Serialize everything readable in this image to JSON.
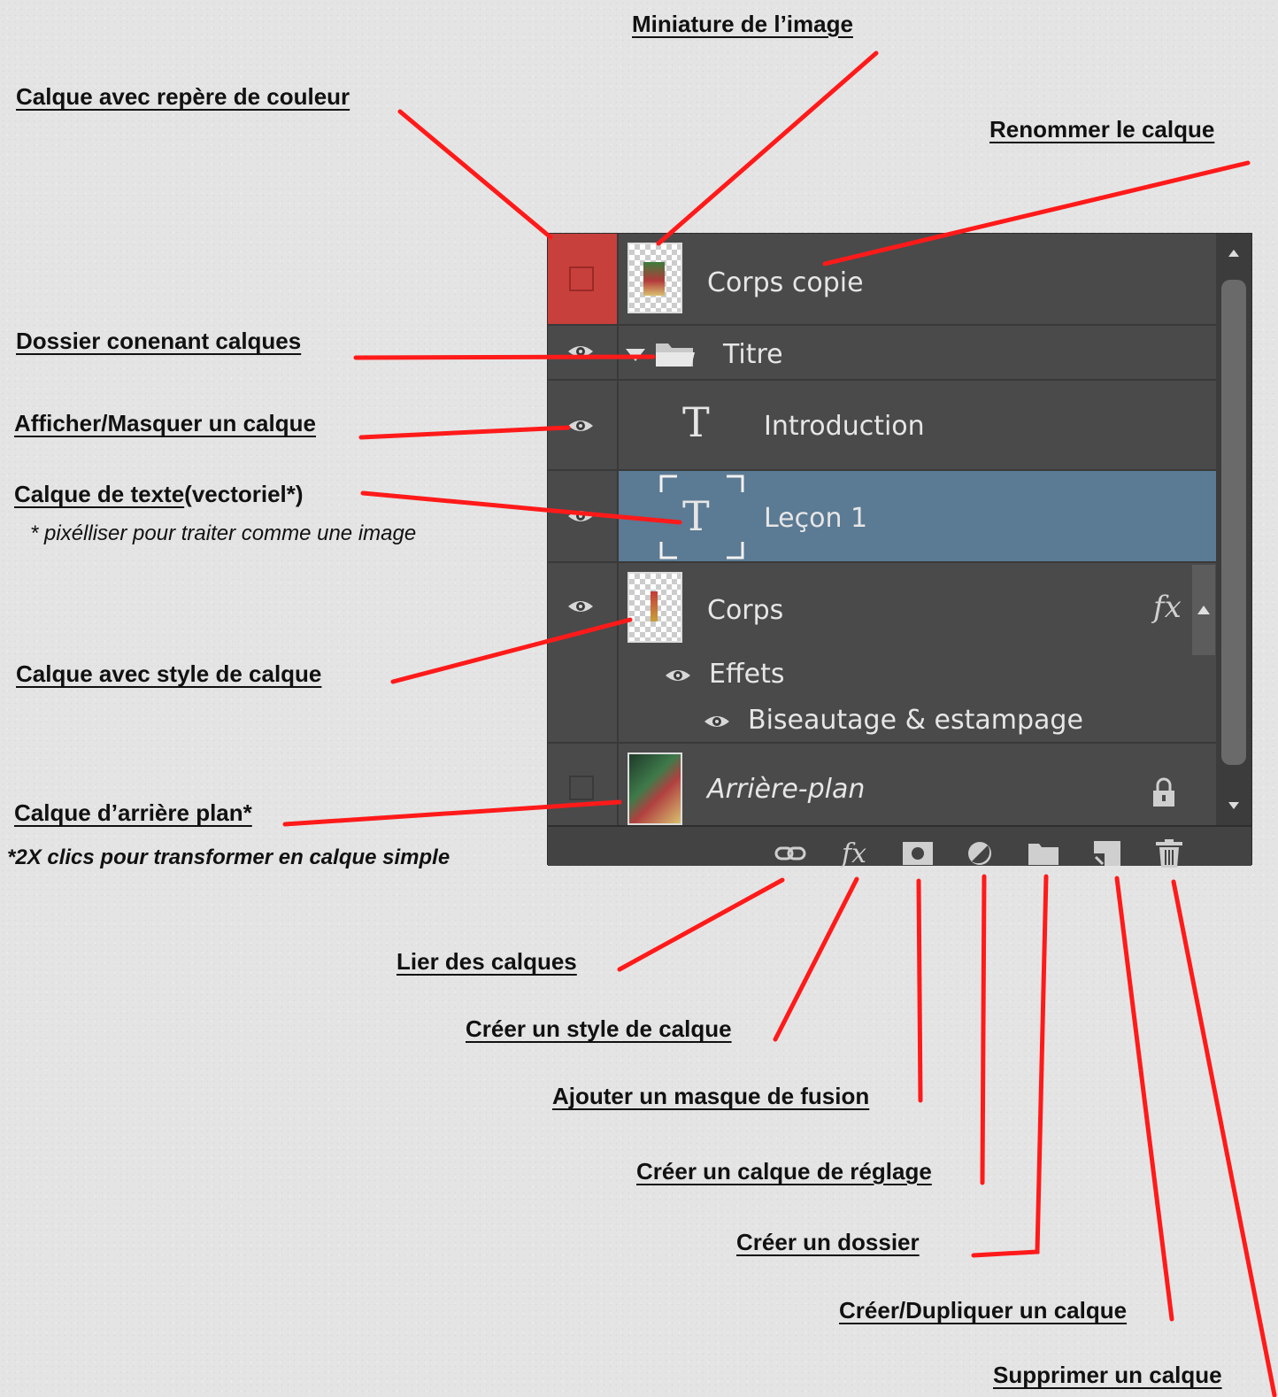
{
  "annotations": {
    "miniature": "Miniature de l’image",
    "color_marker": "Calque avec repère de couleur",
    "rename": "Renommer le calque",
    "folder": "Dossier conenant  calques",
    "show_hide": "Afficher/Masquer un calque",
    "text_layer_a": "Calque de texte",
    "text_layer_b": " (vectoriel*)",
    "text_layer_note": "* pixélliser pour traiter comme une image",
    "style_layer": "Calque avec style de calque",
    "background_layer": "Calque d’arrière plan*",
    "background_note": "*2X clics pour transformer en calque simple",
    "link": "Lier des calques",
    "create_style": "Créer un style de calque",
    "add_mask": "Ajouter un masque de fusion",
    "adjust_layer": "Créer un calque de réglage",
    "create_folder": "Créer un dossier",
    "create_layer": "Créer/Dupliquer un calque",
    "delete_layer": "Supprimer un calque"
  },
  "layers": {
    "corps_copie": "Corps copie",
    "titre": "Titre",
    "introduction": "Introduction",
    "lecon1": "Leçon 1",
    "corps": "Corps",
    "effets": "Effets",
    "biseautage": "Biseautage & estampage",
    "arriere_plan": "Arrière-plan",
    "fx": "fx"
  },
  "colors": {
    "panel_bg": "#4a4a4a",
    "selected_row": "#5b7a93",
    "color_marker": "#c8403b",
    "annotation_line": "#ff1a1a"
  },
  "icons": [
    "eye-icon",
    "folder-icon",
    "text-T-icon",
    "lock-icon",
    "link-icon",
    "fx-icon",
    "mask-icon",
    "adjustment-icon",
    "new-group-icon",
    "new-layer-icon",
    "trash-icon"
  ]
}
